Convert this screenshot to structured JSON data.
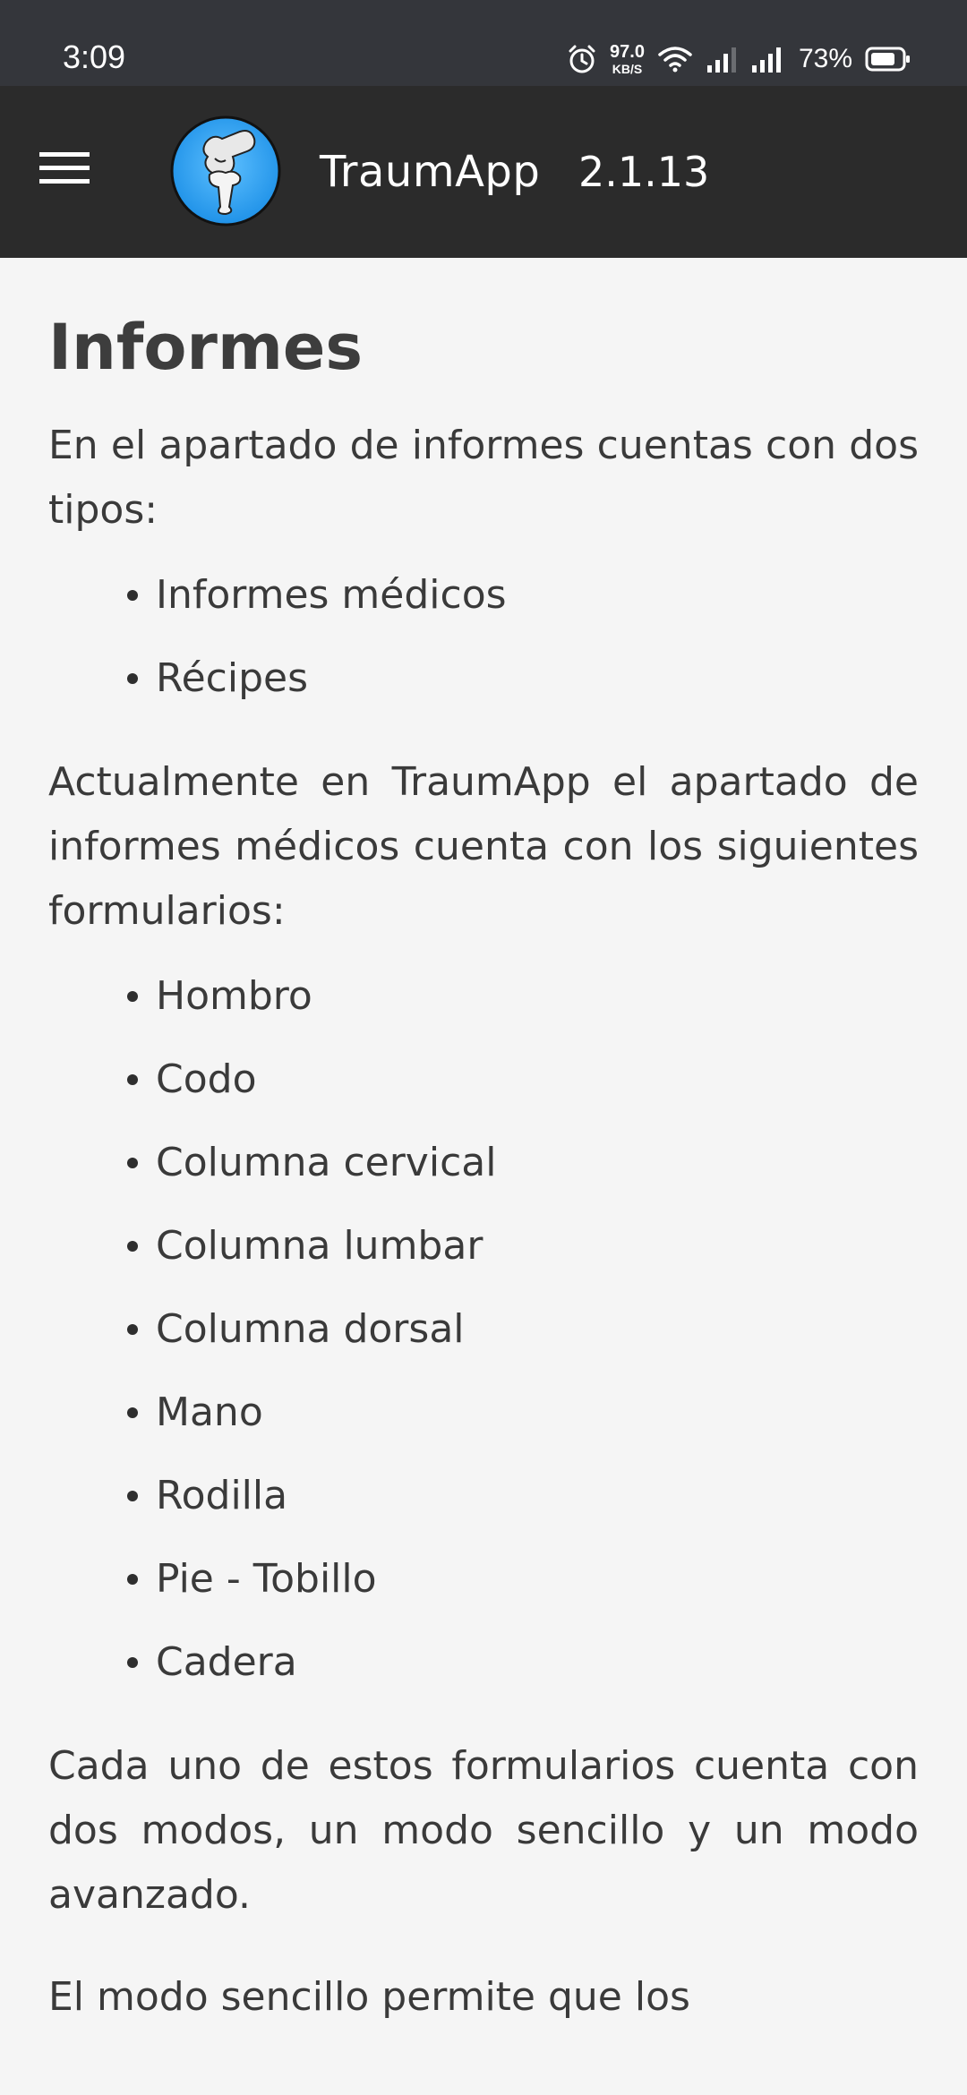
{
  "status_bar": {
    "time": "3:09",
    "net_speed_value": "97.0",
    "net_speed_unit": "KB/S",
    "battery_percent": "73%",
    "icons": [
      "alarm-icon",
      "wifi-icon",
      "signal-icon",
      "signal-icon",
      "battery-icon"
    ]
  },
  "app_bar": {
    "title": "TraumApp",
    "version": "2.1.13",
    "icons": [
      "menu-icon",
      "app-logo"
    ]
  },
  "content": {
    "title": "Informes",
    "intro": "En el apartado de informes cuentas con dos tipos:",
    "report_types": [
      "Informes médicos",
      "Récipes"
    ],
    "forms_intro": "Actualmente en TraumApp el apartado de informes médicos cuenta con los siguientes formularios:",
    "forms": [
      "Hombro",
      "Codo",
      "Columna cervical",
      "Columna lumbar",
      "Columna dorsal",
      "Mano",
      "Rodilla",
      "Pie - Tobillo",
      "Cadera"
    ],
    "modes_text": "Cada uno de estos formularios cuenta con dos modos, un modo sencillo y un modo avanzado.",
    "simple_mode_text": "El modo sencillo permite que los"
  },
  "colors": {
    "status_bar_bg": "#34363b",
    "app_bar_bg": "#2b2b2b",
    "page_bg": "#f5f5f5",
    "text": "#3a3a3a",
    "logo_blue": "#2196f3"
  }
}
